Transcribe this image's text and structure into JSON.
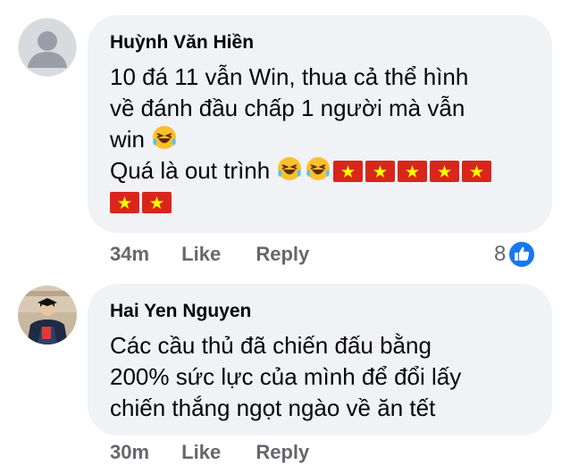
{
  "comments": [
    {
      "author": "Huỳnh Văn Hiền",
      "lines": [
        "10 đá 11 vẫn Win, thua cả thể hình",
        "về đánh đầu chấp 1 người mà vẫn",
        "win",
        "Quá là out trình"
      ],
      "emoji_after_line3": "laughing-crying-emoji",
      "line4_emojis": [
        "laughing-crying-emoji",
        "laughing-crying-emoji"
      ],
      "flags": 7,
      "time": "34m",
      "like_label": "Like",
      "reply_label": "Reply",
      "reaction_count": "8",
      "avatar_icon": "default-person-avatar-icon"
    },
    {
      "author": "Hai Yen Nguyen",
      "lines": [
        "Các cầu thủ đã chiến đấu bằng",
        "200% sức lực của mình để đổi lấy",
        "chiến thắng ngọt ngào về ăn tết"
      ],
      "time": "30m",
      "like_label": "Like",
      "reply_label": "Reply",
      "avatar_icon": "profile-photo-avatar"
    }
  ],
  "colors": {
    "bubble": "#f0f2f5",
    "meta": "#65676b",
    "like_blue": "#1877f2",
    "flag_red": "#da251d",
    "flag_star": "#ffff00"
  }
}
